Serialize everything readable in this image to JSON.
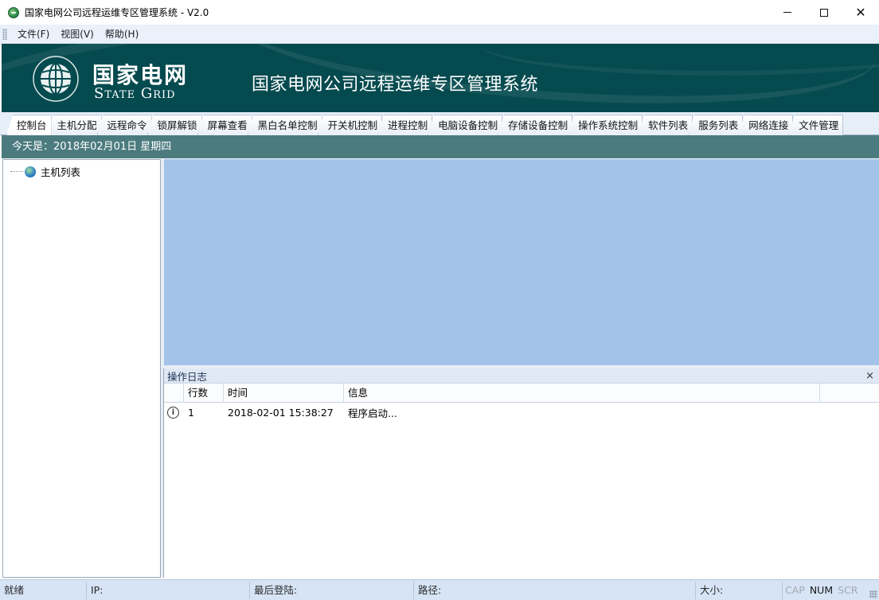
{
  "window": {
    "title": "国家电网公司远程运维专区管理系统 - V2.0",
    "controls": [
      "minimize",
      "maximize",
      "close"
    ]
  },
  "menubar": {
    "items": [
      "文件(F)",
      "视图(V)",
      "帮助(H)"
    ]
  },
  "banner": {
    "logo_cn": "国家电网",
    "logo_en": "State Grid",
    "title": "国家电网公司远程运维专区管理系统",
    "background_color": "#054a4f"
  },
  "tabs": [
    {
      "label": "控制台",
      "active": true
    },
    {
      "label": "主机分配"
    },
    {
      "label": "远程命令"
    },
    {
      "label": "锁屏解锁"
    },
    {
      "label": "屏幕查看"
    },
    {
      "label": "黑白名单控制"
    },
    {
      "label": "开关机控制"
    },
    {
      "label": "进程控制"
    },
    {
      "label": "电脑设备控制"
    },
    {
      "label": "存储设备控制"
    },
    {
      "label": "操作系统控制"
    },
    {
      "label": "软件列表"
    },
    {
      "label": "服务列表"
    },
    {
      "label": "网络连接"
    },
    {
      "label": "文件管理"
    }
  ],
  "datebar": {
    "text": "今天是：2018年02月01日   星期四"
  },
  "tree": {
    "root_label": "主机列表"
  },
  "log": {
    "title": "操作日志",
    "close_symbol": "×",
    "columns": [
      "行数",
      "时间",
      "信息"
    ],
    "rows": [
      {
        "line": "1",
        "time": "2018-02-01 15:38:27",
        "message": "程序启动..."
      }
    ]
  },
  "statusbar": {
    "ready": "就绪",
    "ip_label": "IP:",
    "last_login_label": "最后登陆:",
    "path_label": "路径:",
    "size_label": "大小:",
    "keys": [
      {
        "label": "CAP",
        "on": false
      },
      {
        "label": "NUM",
        "on": true
      },
      {
        "label": "SCR",
        "on": false
      }
    ]
  }
}
